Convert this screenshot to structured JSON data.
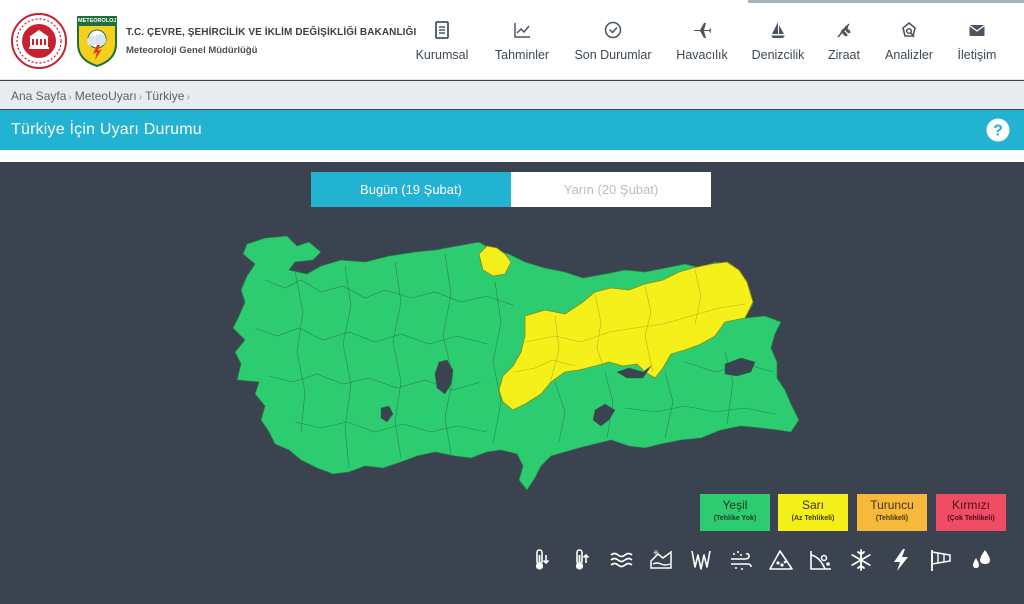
{
  "header": {
    "org_name": "T.C. ÇEVRE, ŞEHİRCİLİK VE İKLİM DEĞİŞİKLİĞİ BAKANLIĞI",
    "org_sub": "Meteoroloji Genel Müdürlüğü",
    "meteo_logo_text": "METEOROLOJİ"
  },
  "nav": [
    {
      "label": "Kurumsal",
      "icon": "document-icon"
    },
    {
      "label": "Tahminler",
      "icon": "chart-icon"
    },
    {
      "label": "Son Durumlar",
      "icon": "check-circle-icon"
    },
    {
      "label": "Havacılık",
      "icon": "airplane-icon"
    },
    {
      "label": "Denizcilik",
      "icon": "sailboat-icon"
    },
    {
      "label": "Ziraat",
      "icon": "wheat-icon"
    },
    {
      "label": "Analizler",
      "icon": "analysis-icon"
    },
    {
      "label": "İletişim",
      "icon": "envelope-icon"
    }
  ],
  "breadcrumb": [
    "Ana Sayfa",
    "MeteoUyarı",
    "Türkiye"
  ],
  "page_title": "Türkiye İçin Uyarı Durumu",
  "tabs": {
    "today": "Bugün (19 Şubat)",
    "tomorrow": "Yarın (20 Şubat)",
    "active": "today"
  },
  "map": {
    "colors": {
      "green": "#2ecc71",
      "yellow": "#f5ef1a",
      "lake": "#3b4350"
    },
    "warning_regions": "yellow"
  },
  "legend": [
    {
      "name": "Yeşil",
      "desc": "(Tehlike Yok)",
      "color": "#2ecc71"
    },
    {
      "name": "Sarı",
      "desc": "(Az Tehlikeli)",
      "color": "#f5ef1a"
    },
    {
      "name": "Turuncu",
      "desc": "(Tehlikeli)",
      "color": "#f6b93b"
    },
    {
      "name": "Kırmızı",
      "desc": "(Çok Tehlikeli)",
      "color": "#ef4d64"
    }
  ],
  "hazards": [
    "cold-thermometer-icon",
    "hot-thermometer-icon",
    "fog-icon",
    "snowmelt-icon",
    "icing-icon",
    "dust-icon",
    "avalanche-icon",
    "landslide-icon",
    "snowflake-icon",
    "lightning-icon",
    "windsock-icon",
    "rain-drops-icon"
  ]
}
